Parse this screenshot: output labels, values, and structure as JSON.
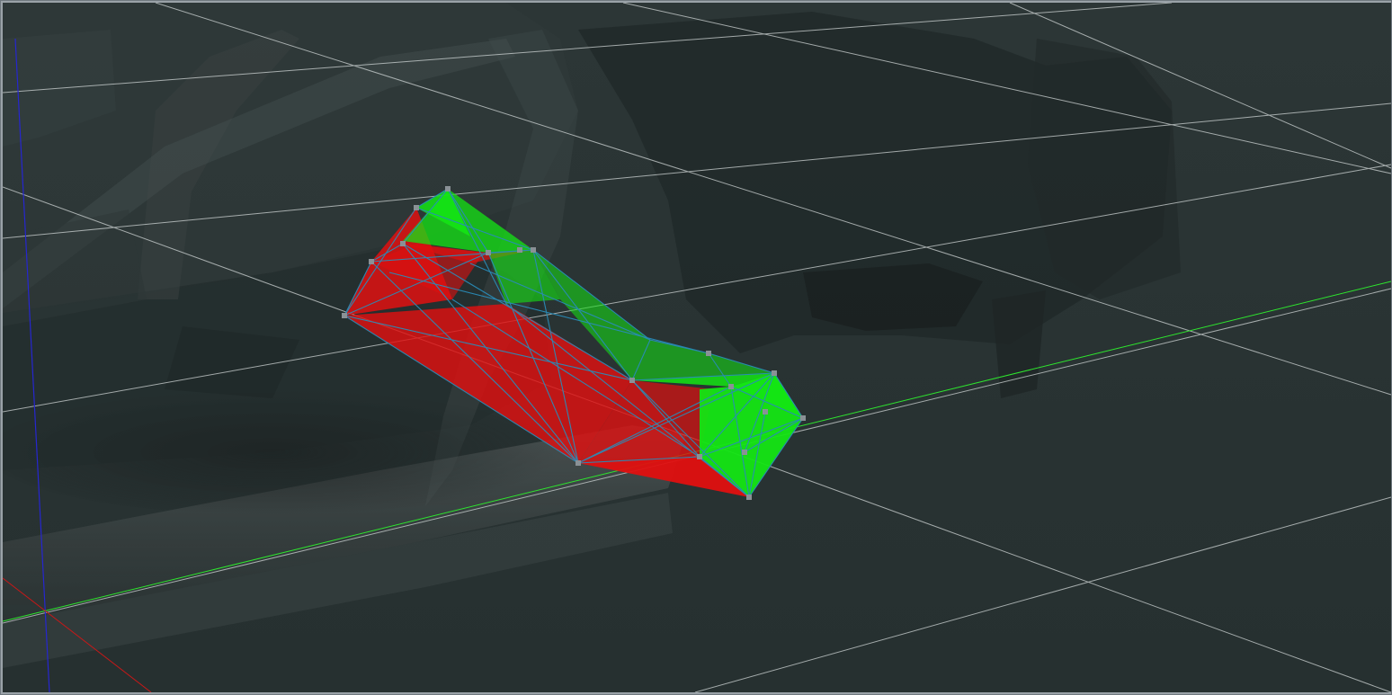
{
  "viewport": {
    "background_color": "#2a3434",
    "grid_color": "#d0d6d6",
    "axis_colors": {
      "x_axis": "#c81818",
      "y_axis": "#2ee62e",
      "z_axis": "#2424c8"
    },
    "selection_face_colors": {
      "red_region": "#e01010",
      "green_region": "#14e614"
    },
    "wireframe_edge_color": "#2a8cb8",
    "vertex_handle_color": "#8a9196",
    "background_model_color": "#3c4444"
  }
}
